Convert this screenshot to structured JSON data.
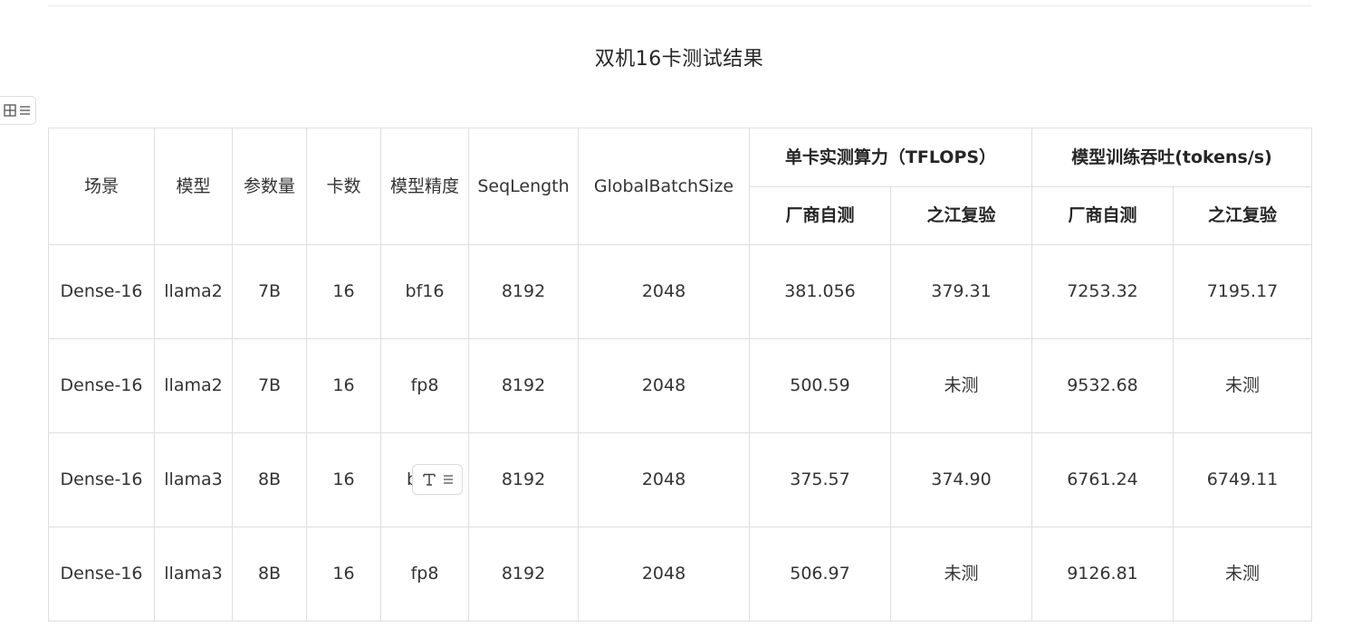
{
  "title": "双机16卡测试结果",
  "icons": {
    "table_toolbar": [
      "table-grid-icon",
      "menu-lines-icon"
    ],
    "text_toolbar": [
      "text-format-icon",
      "menu-lines-icon"
    ]
  },
  "table": {
    "headers": {
      "scene": "场景",
      "model": "模型",
      "params": "参数量",
      "cards": "卡数",
      "precision": "模型精度",
      "seqlength": "SeqLength",
      "global_batch_size": "GlobalBatchSize",
      "group_tflops": "单卡实测算力（TFLOPS）",
      "group_throughput": "模型训练吞吐(tokens/s)",
      "vendor_test": "厂商自测",
      "zhijiang_retest": "之江复验"
    },
    "rows": [
      {
        "scene": "Dense-16",
        "model": "llama2",
        "params": "7B",
        "cards": "16",
        "precision": "bf16",
        "seqlength": "8192",
        "gbs": "2048",
        "tflops_vendor": "381.056",
        "tflops_zj": "379.31",
        "tput_vendor": "7253.32",
        "tput_zj": "7195.17"
      },
      {
        "scene": "Dense-16",
        "model": "llama2",
        "params": "7B",
        "cards": "16",
        "precision": "fp8",
        "seqlength": "8192",
        "gbs": "2048",
        "tflops_vendor": "500.59",
        "tflops_zj": "未测",
        "tput_vendor": "9532.68",
        "tput_zj": "未测"
      },
      {
        "scene": "Dense-16",
        "model": "llama3",
        "params": "8B",
        "cards": "16",
        "precision": "b",
        "seqlength": "8192",
        "gbs": "2048",
        "tflops_vendor": "375.57",
        "tflops_zj": "374.90",
        "tput_vendor": "6761.24",
        "tput_zj": "6749.11"
      },
      {
        "scene": "Dense-16",
        "model": "llama3",
        "params": "8B",
        "cards": "16",
        "precision": "fp8",
        "seqlength": "8192",
        "gbs": "2048",
        "tflops_vendor": "506.97",
        "tflops_zj": "未测",
        "tput_vendor": "9126.81",
        "tput_zj": "未测"
      }
    ]
  }
}
